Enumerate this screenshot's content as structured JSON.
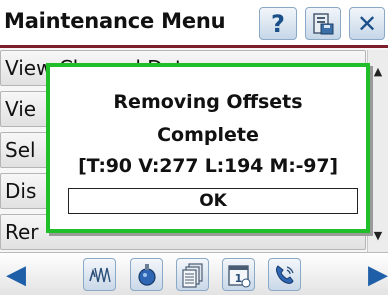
{
  "header": {
    "title": "Maintenance Menu",
    "help_label": "?",
    "close_label": "✕"
  },
  "menu": {
    "items": [
      {
        "label": "View Channel Data"
      },
      {
        "label": "Vie"
      },
      {
        "label": "Sel"
      },
      {
        "label": "Dis"
      },
      {
        "label": "Rer"
      }
    ]
  },
  "dialog": {
    "title": "Removing Offsets",
    "status": "Complete",
    "values": "[T:90 V:277 L:194 M:-97]",
    "ok_label": "OK",
    "border_color": "#1fbf2a"
  },
  "footer": {
    "left_arrow": "◀",
    "right_arrow": "▶",
    "icons": [
      "waveform-icon",
      "sensor-icon",
      "pages-icon",
      "calendar-1-icon",
      "phone-icon"
    ]
  },
  "colors": {
    "header_rule": "#7b1f2a",
    "accent_blue": "#1f5fa8"
  }
}
